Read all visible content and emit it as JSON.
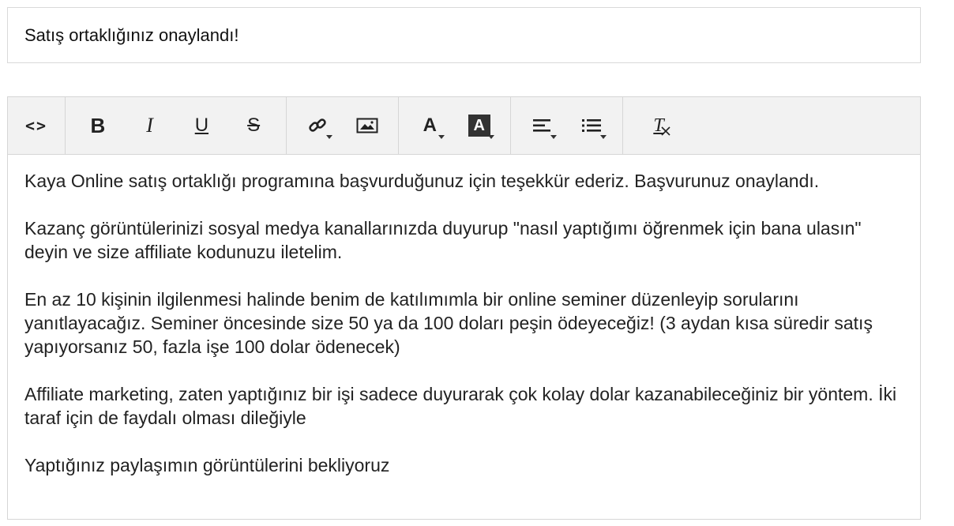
{
  "subject": {
    "value": "Satış ortaklığınız onaylandı!"
  },
  "toolbar": {
    "source": {
      "label": "<>",
      "icon": "code-icon"
    },
    "bold": {
      "label": "B",
      "icon": "bold-icon"
    },
    "italic": {
      "label": "I",
      "icon": "italic-icon"
    },
    "underline": {
      "label": "U",
      "icon": "underline-icon"
    },
    "strike": {
      "label": "S",
      "icon": "strikethrough-icon"
    },
    "link": {
      "icon": "link-icon"
    },
    "image": {
      "icon": "image-icon"
    },
    "font_color": {
      "label": "A",
      "icon": "font-color-icon"
    },
    "bg_color": {
      "label": "A",
      "icon": "highlight-color-icon"
    },
    "align": {
      "icon": "align-left-icon"
    },
    "list": {
      "icon": "bulleted-list-icon"
    },
    "clear_format": {
      "label": "T",
      "icon": "clear-format-icon"
    }
  },
  "body": {
    "paragraphs": [
      "Kaya Online satış ortaklığı programına başvurduğunuz için teşekkür ederiz. Başvurunuz onaylandı.",
      "Kazanç görüntülerinizi sosyal medya kanallarınızda duyurup \"nasıl yaptığımı öğrenmek için bana ulasın\" deyin ve size affiliate kodunuzu iletelim.",
      "En az 10 kişinin ilgilenmesi halinde benim de katılımımla bir online seminer düzenleyip sorularını yanıtlayacağız. Seminer öncesinde size 50 ya da 100 doları peşin ödeyeceğiz! (3 aydan kısa süredir satış yapıyorsanız 50, fazla işe 100 dolar ödenecek)",
      "Affiliate marketing, zaten yaptığınız bir işi sadece duyurarak çok kolay dolar kazanabileceğiniz bir yöntem. İki taraf için de faydalı olması dileğiyle",
      "Yaptığınız paylaşımın görüntülerini bekliyoruz"
    ]
  }
}
